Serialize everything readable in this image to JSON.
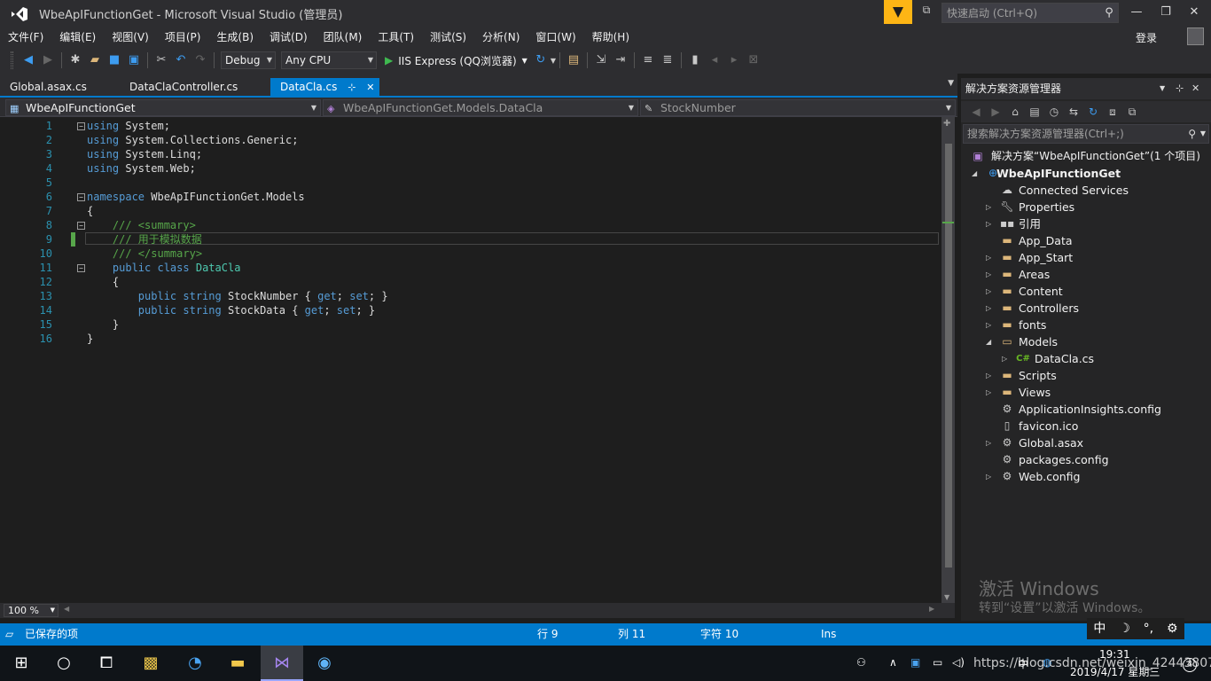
{
  "window": {
    "title": "WbeApIFunctionGet - Microsoft Visual Studio (管理员)",
    "quick_launch_placeholder": "快速启动 (Ctrl+Q)",
    "login": "登录"
  },
  "menu": [
    "文件(F)",
    "编辑(E)",
    "视图(V)",
    "项目(P)",
    "生成(B)",
    "调试(D)",
    "团队(M)",
    "工具(T)",
    "测试(S)",
    "分析(N)",
    "窗口(W)",
    "帮助(H)"
  ],
  "toolbar": {
    "config": "Debug",
    "platform": "Any CPU",
    "run_target": "IIS Express (QQ浏览器)"
  },
  "tabs": [
    {
      "label": "Global.asax.cs",
      "active": false
    },
    {
      "label": "DataClaController.cs",
      "active": false
    },
    {
      "label": "DataCla.cs",
      "active": true
    }
  ],
  "navbar": {
    "project": "WbeApIFunctionGet",
    "type": "WbeApIFunctionGet.Models.DataCla",
    "member": "StockNumber"
  },
  "editor": {
    "line_numbers": [
      "1",
      "2",
      "3",
      "4",
      "5",
      "6",
      "7",
      "8",
      "9",
      "10",
      "11",
      "12",
      "13",
      "14",
      "15",
      "16"
    ],
    "zoom": "100 %"
  },
  "solution_explorer": {
    "title": "解决方案资源管理器",
    "search_placeholder": "搜索解决方案资源管理器(Ctrl+;)",
    "solution": "解决方案“WbeApIFunctionGet”(1 个项目)",
    "project": "WbeApIFunctionGet",
    "items": [
      {
        "label": "Connected Services",
        "icon": "cloud-icon",
        "expandable": false
      },
      {
        "label": "Properties",
        "icon": "wrench-icon",
        "expandable": true
      },
      {
        "label": "引用",
        "icon": "references-icon",
        "expandable": true
      },
      {
        "label": "App_Data",
        "icon": "folder-icon",
        "expandable": false
      },
      {
        "label": "App_Start",
        "icon": "folder-icon",
        "expandable": true
      },
      {
        "label": "Areas",
        "icon": "folder-icon",
        "expandable": true
      },
      {
        "label": "Content",
        "icon": "folder-icon",
        "expandable": true
      },
      {
        "label": "Controllers",
        "icon": "folder-icon",
        "expandable": true
      },
      {
        "label": "fonts",
        "icon": "folder-icon",
        "expandable": true
      },
      {
        "label": "Models",
        "icon": "folder-open-icon",
        "expandable": true,
        "expanded": true
      },
      {
        "label": "DataCla.cs",
        "icon": "csharp-file-icon",
        "expandable": true,
        "child": true
      },
      {
        "label": "Scripts",
        "icon": "folder-icon",
        "expandable": true
      },
      {
        "label": "Views",
        "icon": "folder-icon",
        "expandable": true
      },
      {
        "label": "ApplicationInsights.config",
        "icon": "config-file-icon",
        "expandable": false
      },
      {
        "label": "favicon.ico",
        "icon": "file-icon",
        "expandable": false
      },
      {
        "label": "Global.asax",
        "icon": "file-icon",
        "expandable": true
      },
      {
        "label": "packages.config",
        "icon": "config-file-icon",
        "expandable": false
      },
      {
        "label": "Web.config",
        "icon": "config-file-icon",
        "expandable": true
      }
    ],
    "activation_line1": "激活 Windows",
    "activation_line2": "转到“设置”以激活 Windows。"
  },
  "statusbar": {
    "message": "已保存的项",
    "line": "行 9",
    "col": "列 11",
    "ch": "字符 10",
    "mode": "Ins"
  },
  "taskbar": {
    "time": "19:31",
    "date": "2019/4/17 星期三",
    "watermark": "https://blog.csdn.net/weixin_42443807",
    "ime": "中"
  }
}
